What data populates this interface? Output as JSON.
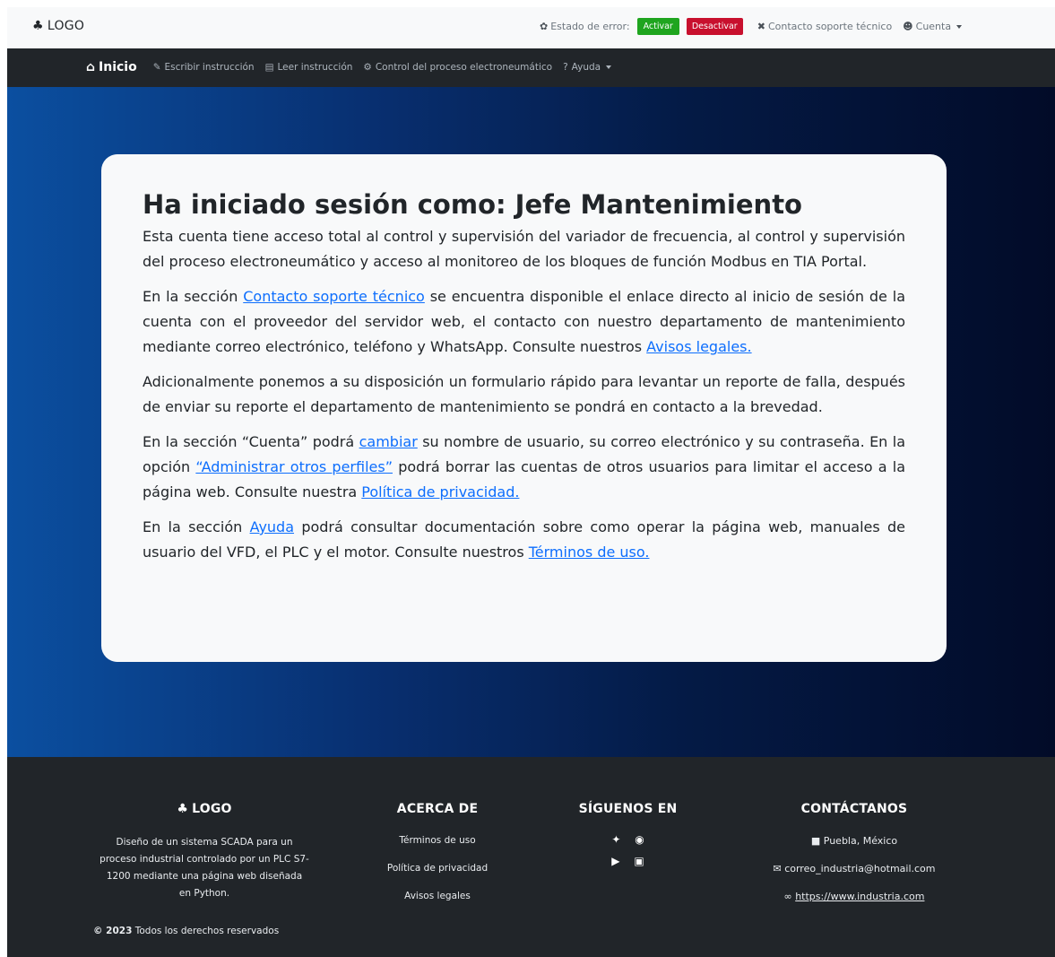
{
  "topbar": {
    "brand": "LOGO",
    "error_state_label": "Estado de error:",
    "activate_label": "Activar",
    "deactivate_label": "Desactivar",
    "support_label": "Contacto soporte técnico",
    "account_label": "Cuenta"
  },
  "nav": {
    "items": [
      {
        "label": "Inicio"
      },
      {
        "label": "Escribir instrucción"
      },
      {
        "label": "Leer instrucción"
      },
      {
        "label": "Control del proceso electroneumático"
      },
      {
        "label": "Ayuda"
      }
    ]
  },
  "card": {
    "title": "Ha iniciado sesión como: Jefe Mantenimiento",
    "p1": "Esta cuenta tiene acceso total al control y supervisión del variador de frecuencia, al control y supervisión del proceso electroneumático y acceso al monitoreo de los bloques de función Modbus en TIA Portal.",
    "p2_a": "En la sección ",
    "p2_link1": "Contacto soporte técnico",
    "p2_b": " se encuentra disponible el enlace directo al inicio de sesión de la cuenta con el proveedor del servidor web, el contacto con nuestro departamento de mantenimiento mediante correo electrónico, teléfono y WhatsApp. Consulte nuestros ",
    "p2_link2": "Avisos legales.",
    "p3": "Adicionalmente ponemos a su disposición un formulario rápido para levantar un reporte de falla, después de enviar su reporte el departamento de mantenimiento se pondrá en contacto a la brevedad.",
    "p4_a": "En la sección “Cuenta” podrá ",
    "p4_link1": "cambiar",
    "p4_b": " su nombre de usuario, su correo electrónico y su contraseña. En la opción ",
    "p4_link2": "“Administrar otros perfiles”",
    "p4_c": " podrá borrar las cuentas de otros usuarios para limitar el acceso a la página web. Consulte nuestra ",
    "p4_link3": "Política de privacidad.",
    "p5_a": "En la sección ",
    "p5_link1": "Ayuda",
    "p5_b": " podrá consultar documentación sobre como operar la página web, manuales de usuario del VFD, el PLC y el motor. Consulte nuestros ",
    "p5_link2": "Términos de uso."
  },
  "footer": {
    "brand": "LOGO",
    "description": "Diseño de un sistema SCADA para un proceso industrial controlado por un PLC S7-1200 mediante una página web diseñada en Python.",
    "about_title": "ACERCA DE",
    "about_links": [
      "Términos de uso",
      "Política de privacidad",
      "Avisos legales"
    ],
    "follow_title": "SÍGUENOS EN",
    "contact_title": "CONTÁCTANOS",
    "location": "Puebla, México",
    "email": "correo_industria@hotmail.com",
    "website": "https://www.industria.com",
    "copyright_year": "© 2023",
    "copyright_text": " Todos los derechos reservados"
  }
}
